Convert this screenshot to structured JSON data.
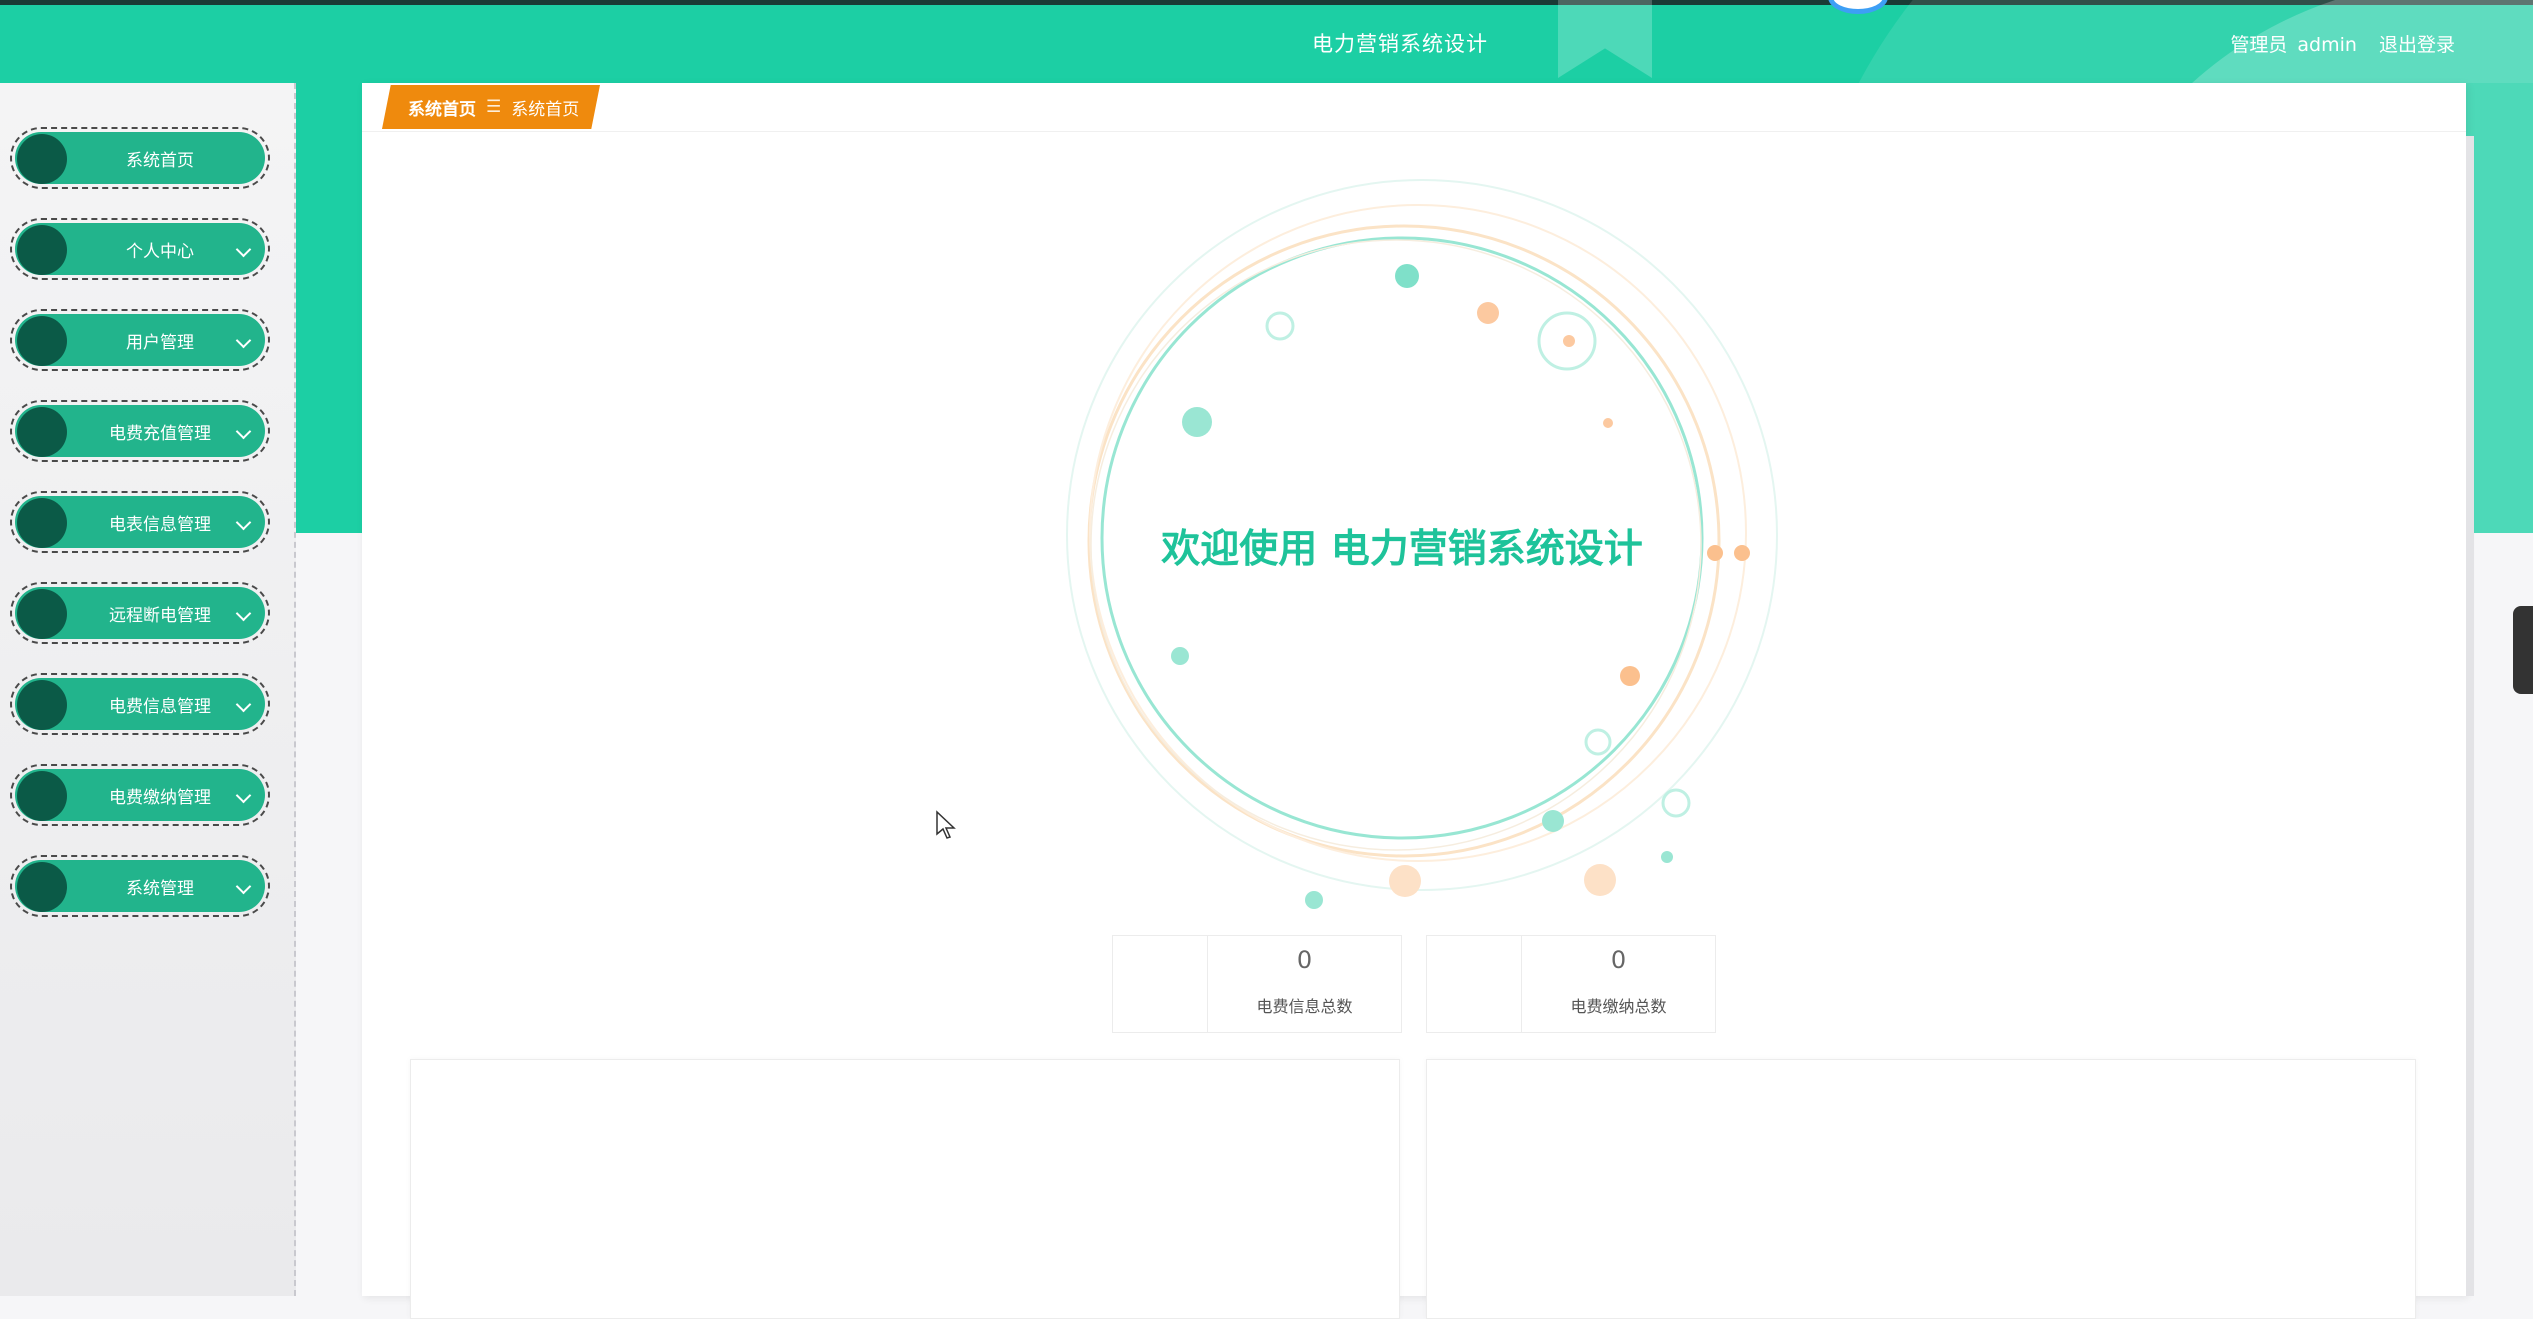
{
  "header": {
    "title": "电力营销系统设计",
    "user_role": "管理员",
    "username": "admin",
    "logout_label": "退出登录"
  },
  "sidebar": {
    "items": [
      {
        "label": "系统首页",
        "has_submenu": false
      },
      {
        "label": "个人中心",
        "has_submenu": true
      },
      {
        "label": "用户管理",
        "has_submenu": true
      },
      {
        "label": "电费充值管理",
        "has_submenu": true
      },
      {
        "label": "电表信息管理",
        "has_submenu": true
      },
      {
        "label": "远程断电管理",
        "has_submenu": true
      },
      {
        "label": "电费信息管理",
        "has_submenu": true
      },
      {
        "label": "电费缴纳管理",
        "has_submenu": true
      },
      {
        "label": "系统管理",
        "has_submenu": true
      }
    ]
  },
  "breadcrumb": {
    "first": "系统首页",
    "separator": "☰",
    "current": "系统首页"
  },
  "welcome": {
    "text": "欢迎使用 电力营销系统设计"
  },
  "stats": [
    {
      "value": "0",
      "label": "电费信息总数"
    },
    {
      "value": "0",
      "label": "电费缴纳总数"
    }
  ],
  "colors": {
    "primary": "#1ccfa4",
    "menu": "#22b48c",
    "menu_dot": "#0b5a47",
    "breadcrumb": "#ef8a0d",
    "welcome_text": "#1ec39a"
  }
}
